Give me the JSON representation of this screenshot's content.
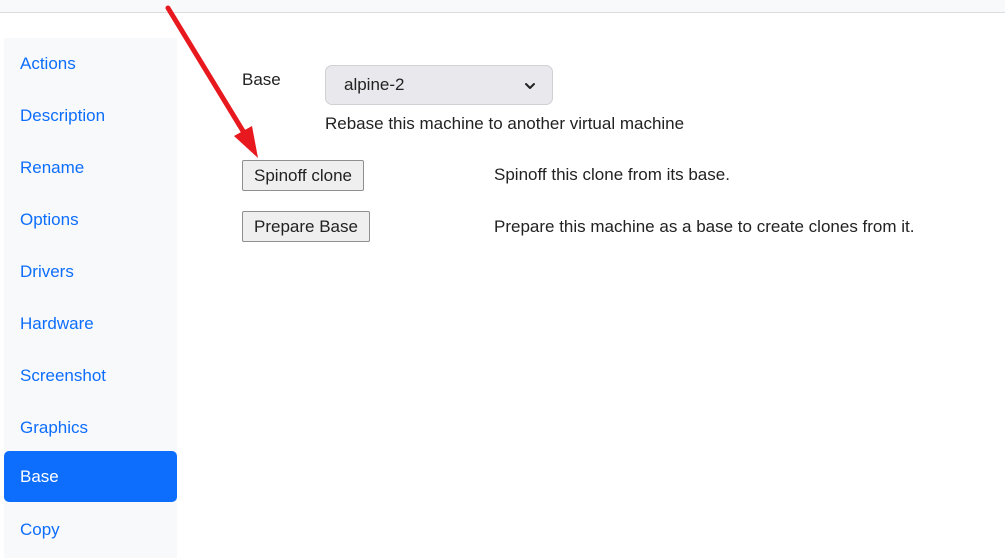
{
  "sidebar": {
    "items": [
      {
        "label": "Actions",
        "active": false
      },
      {
        "label": "Description",
        "active": false
      },
      {
        "label": "Rename",
        "active": false
      },
      {
        "label": "Options",
        "active": false
      },
      {
        "label": "Drivers",
        "active": false
      },
      {
        "label": "Hardware",
        "active": false
      },
      {
        "label": "Screenshot",
        "active": false
      },
      {
        "label": "Graphics",
        "active": false
      },
      {
        "label": "Base",
        "active": true
      },
      {
        "label": "Copy",
        "active": false
      }
    ]
  },
  "base": {
    "label": "Base",
    "selected": "alpine-2",
    "help": "Rebase this machine to another virtual machine"
  },
  "spinoff": {
    "button_label": "Spinoff clone",
    "help": "Spinoff this clone from its base."
  },
  "prepare": {
    "button_label": "Prepare Base",
    "help": "Prepare this machine as a base to create clones from it."
  },
  "colors": {
    "accent": "#0d6efd",
    "sidebar_bg": "#f8f9fa",
    "annotation_arrow": "#e8191e"
  },
  "icons": {
    "select_chevron": "chevron-down-icon",
    "annotation": "red-arrow-annotation"
  }
}
